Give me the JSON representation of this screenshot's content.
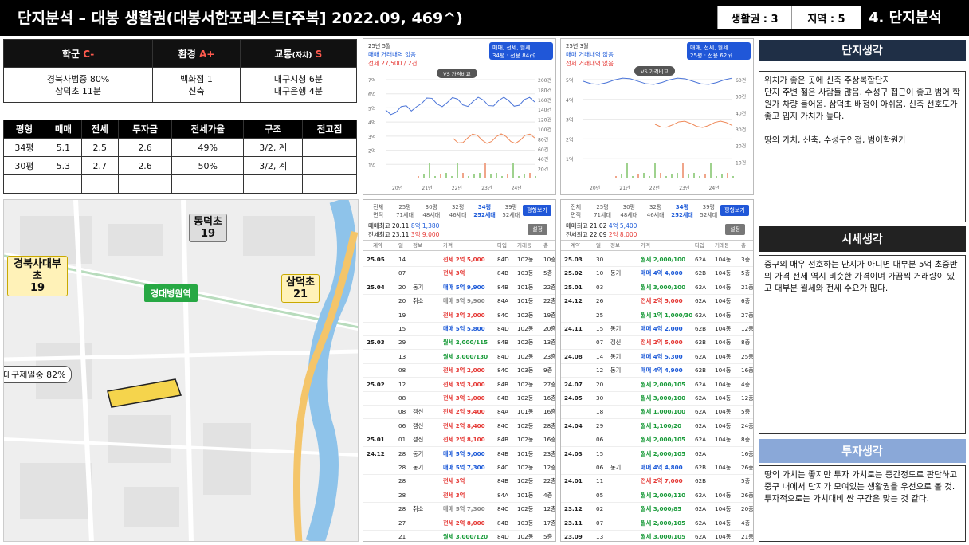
{
  "header": {
    "title": "단지분석 – 대봉 생활권(대봉서한포레스트[주복] 2022.09, 469^)",
    "life": "생활권 : 3",
    "region": "지역 : 5",
    "section": "4. 단지분석"
  },
  "categories": {
    "school": "학군",
    "school_grade": "C-",
    "env": "환경",
    "env_grade": "A+",
    "traffic": "교통",
    "traffic_sub": "(자차)",
    "traffic_grade": "S",
    "school_val": [
      "경북사범중 80%",
      "삼덕초 11분"
    ],
    "env_val": [
      "백화점 1",
      "신축"
    ],
    "traffic_val": [
      "대구시청 6분",
      "대구은행 4분"
    ]
  },
  "price_table": {
    "headers": [
      "평형",
      "매매",
      "전세",
      "투자금",
      "전세가율",
      "구조",
      "전고점"
    ],
    "rows": [
      [
        "34평",
        "5.1",
        "2.5",
        "2.6",
        "49%",
        "3/2, 계",
        ""
      ],
      [
        "30평",
        "5.3",
        "2.7",
        "2.6",
        "50%",
        "3/2, 계",
        ""
      ],
      [
        "",
        "",
        "",
        "",
        "",
        "",
        ""
      ]
    ]
  },
  "map": {
    "labels": [
      {
        "t": "동덕초",
        "n": "19"
      },
      {
        "t": "경북사대부초",
        "n": "19"
      },
      {
        "t": "삼덕초",
        "n": "21"
      }
    ],
    "station": "경대병원역",
    "school_rate": "대구제일중 82%"
  },
  "charts": [
    {
      "period": "25년 5월",
      "sub": "매매 거래내역 없음",
      "jeonse": "전세 27,500 / 2건",
      "box": "매매, 전세, 월세",
      "boxsub": "34평 : 전용 84㎡",
      "vs": "VS 가격비교",
      "y_left": [
        "7억",
        "6억",
        "5억",
        "4억",
        "3억",
        "2억",
        "1억"
      ],
      "y_right": [
        "200건",
        "180건",
        "160건",
        "140건",
        "120건",
        "100건",
        "80건",
        "60건",
        "40건",
        "20건"
      ],
      "x": [
        "20년",
        "21년",
        "22년",
        "23년",
        "24년"
      ]
    },
    {
      "period": "25년 3월",
      "sub": "매매 거래내역 없음",
      "jeonse": "전세 거래내역 없음",
      "box": "매매, 전세, 월세",
      "boxsub": "25평 : 전용 62㎡",
      "vs": "VS 가격비교",
      "y_left": [
        "5억",
        "4억",
        "3억",
        "2억",
        "1억"
      ],
      "y_right": [
        "60건",
        "50건",
        "40건",
        "30건",
        "20건",
        "10건"
      ],
      "x": [
        "20년",
        "21년",
        "22년",
        "23년",
        "24년"
      ]
    }
  ],
  "list1": {
    "tabs": [
      "전체",
      "25평",
      "30평",
      "32평",
      "34평",
      "39평"
    ],
    "tab_sub": [
      "면적",
      "71세대",
      "48세대",
      "46세대",
      "252세대",
      "52세대"
    ],
    "btn": "평형보기",
    "max1": "매매최고 20.11",
    "max1v": "8억 1,380",
    "max2": "전세최고 23.11",
    "max2v": "3억 9,000",
    "set": "설정",
    "cols": [
      "계약",
      "일",
      "정보",
      "가격",
      "타입",
      "거래동",
      "층"
    ],
    "rows": [
      [
        "25.05",
        "14",
        "",
        "전세 2억 5,000",
        "84D",
        "102동",
        "10층"
      ],
      [
        "",
        "07",
        "",
        "전세 3억",
        "84B",
        "103동",
        "5층"
      ],
      [
        "25.04",
        "20",
        "동기",
        "매매 5억 9,900",
        "84B",
        "101동",
        "22층"
      ],
      [
        "",
        "20",
        "취소",
        "매매 5억 9,900",
        "84A",
        "101동",
        "22층"
      ],
      [
        "",
        "19",
        "",
        "전세 3억 3,000",
        "84C",
        "102동",
        "19층"
      ],
      [
        "",
        "15",
        "",
        "매매 5억 5,800",
        "84D",
        "102동",
        "20층"
      ],
      [
        "25.03",
        "29",
        "",
        "월세 2,000/115",
        "84B",
        "102동",
        "13층"
      ],
      [
        "",
        "13",
        "",
        "월세 3,000/130",
        "84D",
        "102동",
        "23층"
      ],
      [
        "",
        "08",
        "",
        "전세 3억 2,000",
        "84C",
        "103동",
        "9층"
      ],
      [
        "25.02",
        "12",
        "",
        "전세 3억 3,000",
        "84B",
        "102동",
        "27층"
      ],
      [
        "",
        "08",
        "",
        "전세 3억 1,000",
        "84B",
        "102동",
        "16층"
      ],
      [
        "",
        "08",
        "갱신",
        "전세 2억 9,400",
        "84A",
        "101동",
        "16층"
      ],
      [
        "",
        "06",
        "갱신",
        "전세 2억 8,400",
        "84C",
        "102동",
        "28층"
      ],
      [
        "25.01",
        "01",
        "갱신",
        "전세 2억 8,100",
        "84B",
        "102동",
        "16층"
      ],
      [
        "24.12",
        "28",
        "동기",
        "매매 5억 9,000",
        "84B",
        "101동",
        "23층"
      ],
      [
        "",
        "28",
        "동기",
        "매매 5억 7,300",
        "84C",
        "102동",
        "12층"
      ],
      [
        "",
        "28",
        "",
        "전세 3억",
        "84B",
        "102동",
        "22층"
      ],
      [
        "",
        "28",
        "",
        "전세 3억",
        "84A",
        "101동",
        "4층"
      ],
      [
        "",
        "28",
        "취소",
        "매매 5억 7,300",
        "84C",
        "102동",
        "12층"
      ],
      [
        "",
        "27",
        "",
        "전세 2억 8,000",
        "84B",
        "103동",
        "17층"
      ],
      [
        "",
        "21",
        "",
        "월세 3,000/120",
        "84D",
        "102동",
        "5층"
      ]
    ]
  },
  "list2": {
    "tabs": [
      "전체",
      "25평",
      "30평",
      "32평",
      "34평",
      "39평"
    ],
    "tab_sub": [
      "면적",
      "71세대",
      "48세대",
      "46세대",
      "252세대",
      "52세대"
    ],
    "btn": "평형보기",
    "max1": "매매최고 21.02",
    "max1v": "4억 5,400",
    "max2": "전세최고 22.09",
    "max2v": "2억 8,000",
    "set": "설정",
    "cols": [
      "계약",
      "일",
      "정보",
      "가격",
      "타입",
      "거래동",
      "층"
    ],
    "rows": [
      [
        "25.03",
        "30",
        "",
        "월세 2,000/100",
        "62A",
        "104동",
        "3층"
      ],
      [
        "25.02",
        "10",
        "동기",
        "매매 4억 4,000",
        "62B",
        "104동",
        "5층"
      ],
      [
        "25.01",
        "03",
        "",
        "월세 3,000/100",
        "62A",
        "104동",
        "21층"
      ],
      [
        "24.12",
        "26",
        "",
        "전세 2억 5,000",
        "62A",
        "104동",
        "6층"
      ],
      [
        "",
        "25",
        "",
        "월세 1억 1,000/30",
        "62A",
        "104동",
        "27층"
      ],
      [
        "24.11",
        "15",
        "동기",
        "매매 4억 2,000",
        "62B",
        "104동",
        "12층"
      ],
      [
        "",
        "07",
        "갱신",
        "전세 2억 5,000",
        "62B",
        "104동",
        "8층"
      ],
      [
        "24.08",
        "14",
        "동기",
        "매매 4억 5,300",
        "62A",
        "104동",
        "25층"
      ],
      [
        "",
        "12",
        "동기",
        "매매 4억 4,900",
        "62B",
        "104동",
        "16층"
      ],
      [
        "24.07",
        "20",
        "",
        "월세 2,000/105",
        "62A",
        "104동",
        "4층"
      ],
      [
        "24.05",
        "30",
        "",
        "월세 3,000/100",
        "62A",
        "104동",
        "12층"
      ],
      [
        "",
        "18",
        "",
        "월세 1,000/100",
        "62A",
        "104동",
        "5층"
      ],
      [
        "24.04",
        "29",
        "",
        "월세 1,100/20",
        "62A",
        "104동",
        "24층"
      ],
      [
        "",
        "06",
        "",
        "월세 2,000/105",
        "62A",
        "104동",
        "8층"
      ],
      [
        "24.03",
        "15",
        "",
        "월세 2,000/105",
        "62A",
        "",
        "16층"
      ],
      [
        "",
        "06",
        "동기",
        "매매 4억 4,800",
        "62B",
        "104동",
        "26층"
      ],
      [
        "24.01",
        "11",
        "",
        "전세 2억 7,000",
        "62B",
        "",
        "5층"
      ],
      [
        "",
        "05",
        "",
        "월세 2,000/110",
        "62A",
        "104동",
        "26층"
      ],
      [
        "23.12",
        "02",
        "",
        "월세 3,000/85",
        "62A",
        "104동",
        "20층"
      ],
      [
        "23.11",
        "07",
        "",
        "월세 2,000/105",
        "62A",
        "104동",
        "4층"
      ],
      [
        "23.09",
        "13",
        "",
        "월세 3,000/105",
        "62A",
        "104동",
        "21층"
      ]
    ]
  },
  "notes": {
    "t1": "단지생각",
    "b1": [
      "위치가 좋은 곳에 신축 주상복합단지",
      "단지 주변 젊은 사람들 많음. 수성구 접근이 좋고 범어 학원가 차량 들어옴. 삼덕초 배정이 아쉬움. 신축 선호도가 좋고 입지 가치가 높다.",
      "",
      "땅의 가치, 신축, 수성구인접, 범어학원가"
    ],
    "t2": "시세생각",
    "b2": [
      "중구의 매우 선호하는 단지가 아니면 대부분 5억 초중반의 가격 전세 역시 비슷한 가격이며 가끔씩 거래량이 있고 대부분 월세와 전세 수요가 많다."
    ],
    "t3": "투자생각",
    "b3": [
      "땅의 가치는 좋지만 투자 가치로는 중간정도로 판단하고 중구 내에서 단지가 모여있는 생활권을 우선으로 볼 것. 투자적으로는 가치대비 싼 구간은 맞는 것 같다."
    ]
  },
  "colors": {
    "red": "#e53935",
    "blue": "#1e5bd8",
    "green": "#1a9b3a",
    "navy": "#1f2f46"
  }
}
